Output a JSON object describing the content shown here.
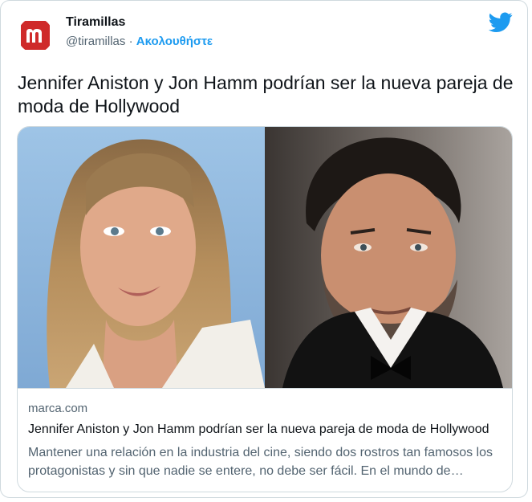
{
  "account": {
    "name": "Tiramillas",
    "handle": "@tiramillas",
    "separator": " · ",
    "follow_label": "Ακολουθήστε",
    "avatar_letter": "m"
  },
  "tweet": {
    "text": "Jennifer Aniston y Jon Hamm podrían ser la nueva pareja de moda de Hollywood"
  },
  "card": {
    "domain": "marca.com",
    "title": "Jennifer Aniston y Jon Hamm podrían ser la nueva pareja de moda de Hollywood",
    "description": "Mantener una relación en la industria del cine, siendo dos rostros tan famosos los protagonistas y sin que nadie se entere, no debe ser fácil. En el mundo de Hollywood es complicado.",
    "image_left": "woman-portrait",
    "image_right": "man-portrait"
  },
  "colors": {
    "brand_red": "#cf2a2a",
    "twitter_blue": "#1d9bf0",
    "text_primary": "#0f1419",
    "text_secondary": "#536471",
    "border": "#cfd9de"
  }
}
